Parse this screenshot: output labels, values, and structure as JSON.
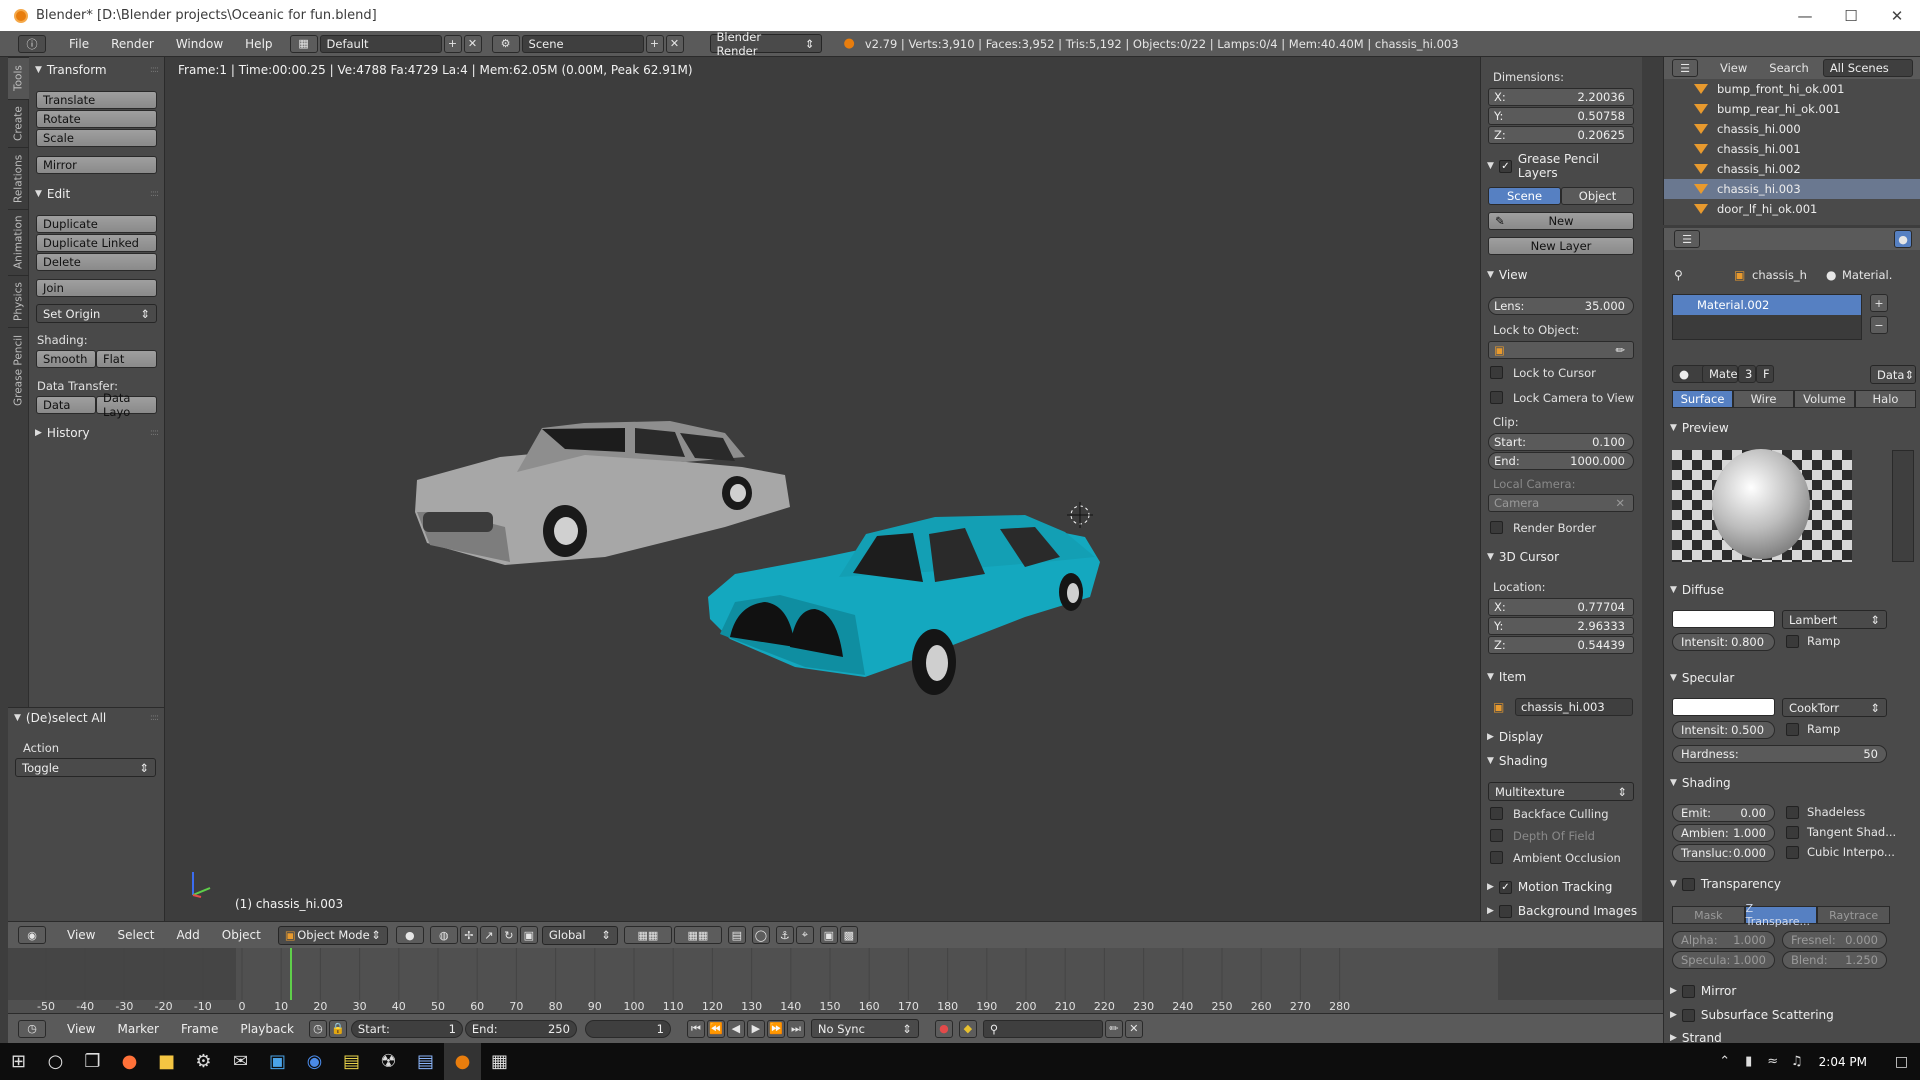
{
  "window": {
    "title": "Blender* [D:\\Blender projects\\Oceanic for fun.blend]"
  },
  "menus": [
    "File",
    "Render",
    "Window",
    "Help"
  ],
  "info": {
    "layout": "Default",
    "scene": "Scene",
    "engine": "Blender Render",
    "stats": "v2.79 | Verts:3,910 | Faces:3,952 | Tris:5,192 | Objects:0/22 | Lamps:0/4 | Mem:40.40M | chassis_hi.003"
  },
  "tool_tabs": [
    "Tools",
    "Create",
    "Relations",
    "Animation",
    "Physics",
    "Grease Pencil"
  ],
  "tools": {
    "transform": {
      "title": "Transform",
      "buttons": [
        "Translate",
        "Rotate",
        "Scale",
        "Mirror"
      ]
    },
    "edit": {
      "title": "Edit",
      "buttons": [
        "Duplicate",
        "Duplicate Linked",
        "Delete",
        "Join"
      ],
      "set_origin": "Set Origin",
      "shading_label": "Shading:",
      "smooth": "Smooth",
      "flat": "Flat",
      "data_transfer_label": "Data Transfer:",
      "data": "Data",
      "data_layout": "Data Layo"
    },
    "history": "History"
  },
  "operator": {
    "title": "(De)select All",
    "action_label": "Action",
    "action_value": "Toggle"
  },
  "viewport": {
    "info": "Frame:1 | Time:00:00.25 | Ve:4788 Fa:4729 La:4 | Mem:62.05M (0.00M, Peak 62.91M)",
    "object_label": "(1) chassis_hi.003",
    "car_colors": {
      "gray": "#9a9a9a",
      "teal": "#14a8bf"
    }
  },
  "npanel": {
    "dimensions_label": "Dimensions:",
    "dims": [
      {
        "axis": "X:",
        "value": "2.20036"
      },
      {
        "axis": "Y:",
        "value": "0.50758"
      },
      {
        "axis": "Z:",
        "value": "0.20625"
      }
    ],
    "grease_pencil": "Grease Pencil Layers",
    "gp_scene": "Scene",
    "gp_object": "Object",
    "gp_new": "New",
    "gp_new_layer": "New Layer",
    "view": "View",
    "lens": "Lens:",
    "lens_value": "35.000",
    "lock_to_object": "Lock to Object:",
    "lock_to_cursor": "Lock to Cursor",
    "lock_camera": "Lock Camera to View",
    "clip": "Clip:",
    "start": "Start:",
    "start_value": "0.100",
    "end": "End:",
    "end_value": "1000.000",
    "local_camera": "Local Camera:",
    "camera": "Camera",
    "render_border": "Render Border",
    "cursor": "3D Cursor",
    "location": "Location:",
    "cursor_loc": [
      {
        "axis": "X:",
        "value": "0.77704"
      },
      {
        "axis": "Y:",
        "value": "2.96333"
      },
      {
        "axis": "Z:",
        "value": "0.54439"
      }
    ],
    "item": "Item",
    "item_name": "chassis_hi.003",
    "display": "Display",
    "shading": "Shading",
    "shading_mode": "Multitexture",
    "backface": "Backface Culling",
    "dof": "Depth Of Field",
    "ao": "Ambient Occlusion",
    "motion": "Motion Tracking",
    "bg_images": "Background Images"
  },
  "outliner": {
    "view": "View",
    "search": "Search",
    "filter": "All Scenes",
    "rows": [
      "bump_front_hi_ok.001",
      "bump_rear_hi_ok.001",
      "chassis_hi.000",
      "chassis_hi.001",
      "chassis_hi.002",
      "chassis_hi.003",
      "door_lf_hi_ok.001"
    ]
  },
  "props": {
    "object": "chassis_h",
    "material_crumb": "Material.",
    "material_slot": "Material.002",
    "mat_field": "Mate",
    "users": "3",
    "fake": "F",
    "data_sel": "Data",
    "tabs": [
      "Surface",
      "Wire",
      "Volume",
      "Halo"
    ],
    "preview": "Preview",
    "diffuse": "Diffuse",
    "diffuse_shader": "Lambert",
    "intensity": "Intensit:",
    "diffuse_intensity": "0.800",
    "ramp": "Ramp",
    "specular": "Specular",
    "spec_shader": "CookTorr",
    "spec_intensity": "0.500",
    "hardness": "Hardness:",
    "hardness_value": "50",
    "shading": "Shading",
    "emit": "Emit:",
    "emit_value": "0.00",
    "ambient": "Ambien:",
    "ambient_value": "1.000",
    "transluc": "Transluc:",
    "transluc_value": "0.000",
    "shadeless": "Shadeless",
    "tangent": "Tangent Shad...",
    "cubic": "Cubic Interpo...",
    "transparency": "Transparency",
    "mask": "Mask",
    "ztrans": "Z Transpare...",
    "raytrace": "Raytrace",
    "alpha": "Alpha:",
    "alpha_value": "1.000",
    "fresnel": "Fresnel:",
    "fresnel_value": "0.000",
    "specula": "Specula:",
    "specula_value": "1.000",
    "blend": "Blend:",
    "blend_value": "1.250",
    "mirror": "Mirror",
    "sss": "Subsurface Scattering",
    "strand": "Strand",
    "accent": "#5680c2"
  },
  "view3d_header": {
    "menus": [
      "View",
      "Select",
      "Add",
      "Object"
    ],
    "mode": "Object Mode",
    "orientation": "Global"
  },
  "timeline": {
    "ticks": [
      "-50",
      "-40",
      "-30",
      "-20",
      "-10",
      "0",
      "10",
      "20",
      "30",
      "40",
      "50",
      "60",
      "70",
      "80",
      "90",
      "100",
      "110",
      "120",
      "130",
      "140",
      "150",
      "160",
      "170",
      "180",
      "190",
      "200",
      "210",
      "220",
      "230",
      "240",
      "250",
      "260",
      "270",
      "280"
    ],
    "menus": [
      "View",
      "Marker",
      "Frame",
      "Playback"
    ],
    "start": "Start:",
    "start_value": "1",
    "end": "End:",
    "end_value": "250",
    "current": "1",
    "sync": "No Sync"
  },
  "taskbar": {
    "time": "2:04 PM"
  }
}
